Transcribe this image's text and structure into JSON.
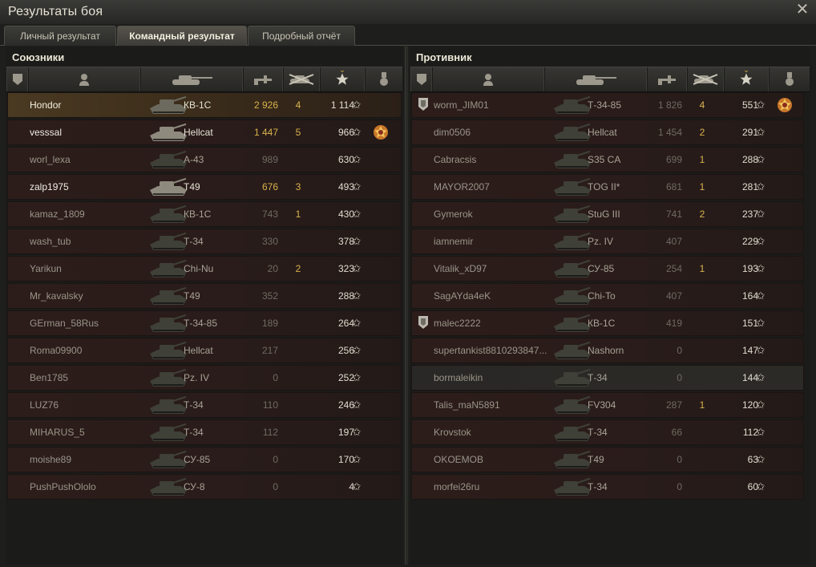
{
  "window": {
    "title": "Результаты боя",
    "close_icon": "close-icon"
  },
  "tabs": [
    {
      "label": "Личный результат",
      "active": false
    },
    {
      "label": "Командный результат",
      "active": true
    },
    {
      "label": "Подробный отчёт",
      "active": false
    }
  ],
  "allies": {
    "title": "Союзники",
    "rows": [
      {
        "name": "Hondor",
        "vehicle": "КВ-1С",
        "damage": "2 926",
        "kills": "4",
        "xp": "1 114",
        "style": "self",
        "medal": false
      },
      {
        "name": "vesssal",
        "vehicle": "Hellcat",
        "damage": "1 447",
        "kills": "5",
        "xp": "966",
        "style": "platoon",
        "medal": true
      },
      {
        "name": "worl_lexa",
        "vehicle": "А-43",
        "damage": "989",
        "kills": "",
        "xp": "630",
        "style": "",
        "medal": false
      },
      {
        "name": "zalp1975",
        "vehicle": "T49",
        "damage": "676",
        "kills": "3",
        "xp": "493",
        "style": "platoon",
        "medal": false
      },
      {
        "name": "kamaz_1809",
        "vehicle": "КВ-1С",
        "damage": "743",
        "kills": "1",
        "xp": "430",
        "style": "",
        "medal": false
      },
      {
        "name": "wash_tub",
        "vehicle": "Т-34",
        "damage": "330",
        "kills": "",
        "xp": "378",
        "style": "",
        "medal": false
      },
      {
        "name": "Yarikun",
        "vehicle": "Chi-Nu",
        "damage": "20",
        "kills": "2",
        "xp": "323",
        "style": "",
        "medal": false
      },
      {
        "name": "Mr_kavalsky",
        "vehicle": "T49",
        "damage": "352",
        "kills": "",
        "xp": "288",
        "style": "",
        "medal": false
      },
      {
        "name": "GErman_58Rus",
        "vehicle": "Т-34-85",
        "damage": "189",
        "kills": "",
        "xp": "264",
        "style": "",
        "medal": false
      },
      {
        "name": "Roma09900",
        "vehicle": "Hellcat",
        "damage": "217",
        "kills": "",
        "xp": "256",
        "style": "",
        "medal": false
      },
      {
        "name": "Ben1785",
        "vehicle": "Pz. IV",
        "damage": "0",
        "kills": "",
        "xp": "252",
        "style": "",
        "medal": false
      },
      {
        "name": "LUZ76",
        "vehicle": "Т-34",
        "damage": "110",
        "kills": "",
        "xp": "246",
        "style": "",
        "medal": false
      },
      {
        "name": "MIHARUS_5",
        "vehicle": "Т-34",
        "damage": "112",
        "kills": "",
        "xp": "197",
        "style": "",
        "medal": false
      },
      {
        "name": "moishe89",
        "vehicle": "СУ-85",
        "damage": "0",
        "kills": "",
        "xp": "170",
        "style": "",
        "medal": false
      },
      {
        "name": "PushPushOlolo",
        "vehicle": "СУ-8",
        "damage": "0",
        "kills": "",
        "xp": "4",
        "style": "",
        "medal": false
      }
    ]
  },
  "enemies": {
    "title": "Противник",
    "rows": [
      {
        "name": "worm_JIM01",
        "vehicle": "Т-34-85",
        "damage": "1 826",
        "kills": "4",
        "xp": "551",
        "style": "",
        "medal": true,
        "badge": true
      },
      {
        "name": "dim0506",
        "vehicle": "Hellcat",
        "damage": "1 454",
        "kills": "2",
        "xp": "291",
        "style": "",
        "medal": false,
        "badge": false
      },
      {
        "name": "Cabracsis",
        "vehicle": "S35 CA",
        "damage": "699",
        "kills": "1",
        "xp": "288",
        "style": "",
        "medal": false,
        "badge": false
      },
      {
        "name": "MAYOR2007",
        "vehicle": "TOG II*",
        "damage": "681",
        "kills": "1",
        "xp": "281",
        "style": "",
        "medal": false,
        "badge": false
      },
      {
        "name": "Gymerok",
        "vehicle": "StuG III",
        "damage": "741",
        "kills": "2",
        "xp": "237",
        "style": "",
        "medal": false,
        "badge": false
      },
      {
        "name": "iamnemir",
        "vehicle": "Pz. IV",
        "damage": "407",
        "kills": "",
        "xp": "229",
        "style": "",
        "medal": false,
        "badge": false
      },
      {
        "name": "Vitalik_xD97",
        "vehicle": "СУ-85",
        "damage": "254",
        "kills": "1",
        "xp": "193",
        "style": "",
        "medal": false,
        "badge": false
      },
      {
        "name": "SagAYda4eK",
        "vehicle": "Chi-To",
        "damage": "407",
        "kills": "",
        "xp": "164",
        "style": "",
        "medal": false,
        "badge": false
      },
      {
        "name": "malec2222",
        "vehicle": "КВ-1С",
        "damage": "419",
        "kills": "",
        "xp": "151",
        "style": "",
        "medal": false,
        "badge": true
      },
      {
        "name": "supertankist8810293847...",
        "vehicle": "Nashorn",
        "damage": "0",
        "kills": "",
        "xp": "147",
        "style": "",
        "medal": false,
        "badge": false
      },
      {
        "name": "bormaleikin",
        "vehicle": "Т-34",
        "damage": "0",
        "kills": "",
        "xp": "144",
        "style": "hover",
        "medal": false,
        "badge": false
      },
      {
        "name": "Talis_maN5891",
        "vehicle": "FV304",
        "damage": "287",
        "kills": "1",
        "xp": "120",
        "style": "",
        "medal": false,
        "badge": false
      },
      {
        "name": "Krovstok",
        "vehicle": "Т-34",
        "damage": "66",
        "kills": "",
        "xp": "112",
        "style": "",
        "medal": false,
        "badge": false
      },
      {
        "name": "OKOEMOB",
        "vehicle": "T49",
        "damage": "0",
        "kills": "",
        "xp": "63",
        "style": "",
        "medal": false,
        "badge": false
      },
      {
        "name": "morfei26ru",
        "vehicle": "Т-34",
        "damage": "0",
        "kills": "",
        "xp": "60",
        "style": "",
        "medal": false,
        "badge": false
      }
    ]
  },
  "columns": [
    "squad-icon",
    "player-icon",
    "vehicle-icon",
    "damage-icon",
    "kills-icon",
    "xp-star-icon",
    "medal-icon"
  ],
  "star_glyph": "✩",
  "colors": {
    "gold": "#d9b34d",
    "self_row": "#4a3a22",
    "row": "#2c1d1b"
  }
}
